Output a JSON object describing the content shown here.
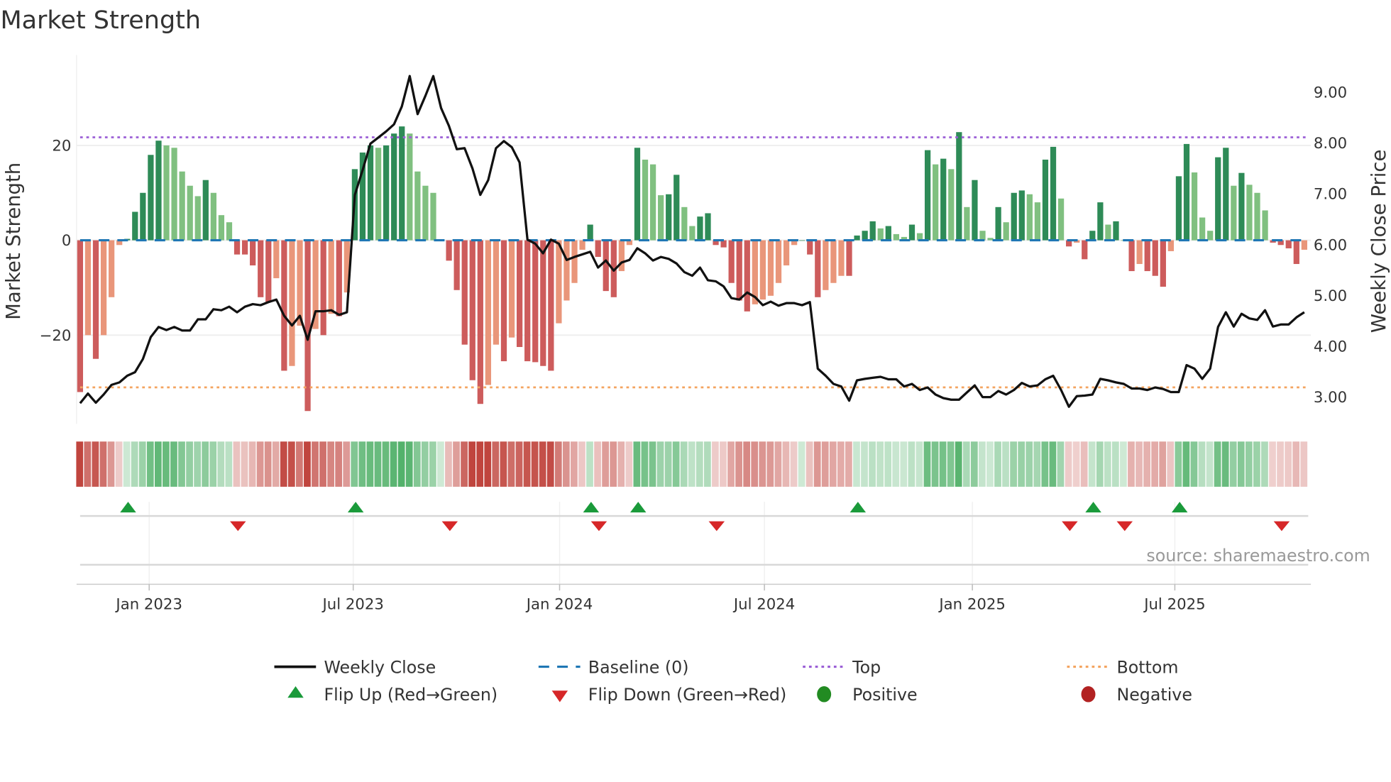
{
  "chart_data": {
    "type": "bar",
    "title": "Market Strength",
    "ylabel": "Market Strength",
    "y2label": "Weekly Close Price",
    "ylim": [
      -38,
      39
    ],
    "y2lim": [
      2.45,
      9.6
    ],
    "yticks": [
      {
        "v": 20,
        "label": "20"
      },
      {
        "v": 0,
        "label": "0"
      },
      {
        "v": -20,
        "label": "−20"
      }
    ],
    "y2ticks": [
      {
        "v": 9,
        "label": "9.00"
      },
      {
        "v": 8,
        "label": "8.00"
      },
      {
        "v": 7,
        "label": "7.00"
      },
      {
        "v": 6,
        "label": "6.00"
      },
      {
        "v": 5,
        "label": "5.00"
      },
      {
        "v": 4,
        "label": "4.00"
      },
      {
        "v": 3,
        "label": "3.00"
      }
    ],
    "x_start": "2022-11-04",
    "x_step": "1 week",
    "xticks": [
      {
        "week": 8.8,
        "label": "Jan 2023"
      },
      {
        "week": 34.8,
        "label": "Jul 2023"
      },
      {
        "week": 61.1,
        "label": "Jan 2024"
      },
      {
        "week": 87.2,
        "label": "Jul 2024"
      },
      {
        "week": 113.7,
        "label": "Jan 2025"
      },
      {
        "week": 139.5,
        "label": "Jul 2025"
      }
    ],
    "top_level": 21.7,
    "bottom_level": -31,
    "baseline": 0,
    "strength": [
      -32,
      -20,
      -25,
      -20,
      -12,
      -1,
      0.3,
      6,
      10,
      18,
      21,
      20,
      19.5,
      14.5,
      11.5,
      9.3,
      12.7,
      10,
      5.3,
      3.8,
      -3,
      -3,
      -5.3,
      -12,
      -13,
      -8,
      -27.5,
      -26.5,
      -18,
      -36,
      -18.7,
      -20,
      -15.5,
      -16,
      -11,
      15,
      18.5,
      20,
      19.5,
      20,
      22.5,
      24,
      22.5,
      14.5,
      11.5,
      10,
      0,
      -4.3,
      -10.5,
      -22,
      -29.5,
      -34.5,
      -30.5,
      -22,
      -25.5,
      -20.5,
      -22.5,
      -25.5,
      -25.7,
      -26.5,
      -27.5,
      -17.5,
      -12.7,
      -9,
      -2,
      3.3,
      -3.5,
      -10.7,
      -12,
      -6.5,
      -1,
      19.5,
      17,
      16,
      9.5,
      9.7,
      13.8,
      7,
      3,
      5,
      5.7,
      -1,
      -1.5,
      -9,
      -12.7,
      -15,
      -13.5,
      -12.5,
      -11.7,
      -9,
      -5.3,
      -1,
      0,
      -3,
      -12,
      -10.5,
      -9,
      -7.5,
      -7.5,
      1,
      2,
      4,
      2.5,
      3,
      1.3,
      0.7,
      3.3,
      1.5,
      19,
      16,
      17.2,
      15,
      22.8,
      7,
      12.7,
      2,
      0.5,
      7,
      3.8,
      10,
      10.5,
      9.7,
      8,
      17,
      19.7,
      8.8,
      -1.3,
      -0.5,
      -4,
      2,
      8,
      3.3,
      4,
      0,
      -6.5,
      -5,
      -6.5,
      -7.5,
      -9.8,
      -2.3,
      13.5,
      20.3,
      14.3,
      4.8,
      2,
      17.5,
      19.5,
      11.5,
      14.2,
      11.7,
      10,
      6.3,
      -0.5,
      -1,
      -1.7,
      -5,
      -2
    ],
    "close": [
      2.88,
      3.07,
      2.89,
      3.05,
      3.24,
      3.29,
      3.42,
      3.49,
      3.75,
      4.18,
      4.38,
      4.32,
      4.38,
      4.31,
      4.31,
      4.53,
      4.53,
      4.73,
      4.71,
      4.78,
      4.67,
      4.78,
      4.83,
      4.81,
      4.87,
      4.92,
      4.6,
      4.41,
      4.6,
      4.13,
      4.69,
      4.69,
      4.71,
      4.62,
      4.67,
      6.98,
      7.47,
      7.99,
      8.11,
      8.23,
      8.37,
      8.72,
      9.32,
      8.57,
      8.93,
      9.32,
      8.69,
      8.34,
      7.88,
      7.9,
      7.5,
      6.98,
      7.27,
      7.9,
      8.04,
      7.92,
      7.62,
      6.1,
      6.02,
      5.83,
      6.1,
      6.02,
      5.7,
      5.76,
      5.81,
      5.86,
      5.55,
      5.69,
      5.49,
      5.65,
      5.7,
      5.93,
      5.83,
      5.69,
      5.76,
      5.72,
      5.63,
      5.46,
      5.39,
      5.55,
      5.3,
      5.28,
      5.18,
      4.95,
      4.92,
      5.06,
      4.97,
      4.81,
      4.88,
      4.8,
      4.85,
      4.85,
      4.81,
      4.87,
      3.56,
      3.42,
      3.26,
      3.21,
      2.93,
      3.33,
      3.36,
      3.38,
      3.4,
      3.35,
      3.35,
      3.21,
      3.26,
      3.14,
      3.19,
      3.05,
      2.98,
      2.95,
      2.95,
      3.09,
      3.23,
      3.0,
      3.0,
      3.12,
      3.05,
      3.14,
      3.28,
      3.21,
      3.23,
      3.35,
      3.42,
      3.14,
      2.81,
      3.02,
      3.03,
      3.05,
      3.36,
      3.33,
      3.29,
      3.26,
      3.17,
      3.17,
      3.14,
      3.19,
      3.16,
      3.1,
      3.1,
      3.63,
      3.56,
      3.36,
      3.56,
      4.38,
      4.67,
      4.39,
      4.64,
      4.55,
      4.52,
      4.71,
      4.39,
      4.43,
      4.43,
      4.57,
      4.67
    ],
    "flip_up_weeks": [
      6,
      35,
      65,
      71,
      99,
      129,
      140
    ],
    "flip_down_weeks": [
      20,
      47,
      66,
      81,
      126,
      133,
      153
    ],
    "legend": {
      "weekly_close": "Weekly Close",
      "baseline": "Baseline (0)",
      "top": "Top",
      "bottom": "Bottom",
      "flip_up": "Flip Up (Red→Green)",
      "flip_down": "Flip Down (Green→Red)",
      "positive": "Positive",
      "negative": "Negative"
    },
    "legend_placement": "bottom",
    "source": "source: sharemaestro.com",
    "colors": {
      "green_rising": "#2e8b57",
      "green_falling": "#80c080",
      "red_falling": "#cd5c5c",
      "red_rising": "#e9967a",
      "baseline": "#1f77b4",
      "top": "#9b5fd6",
      "bottom": "#f4a460",
      "close": "#111111",
      "flip_up": "#1a9a3a",
      "flip_down": "#d62728",
      "positive": "#228b22",
      "negative": "#b22222"
    }
  }
}
